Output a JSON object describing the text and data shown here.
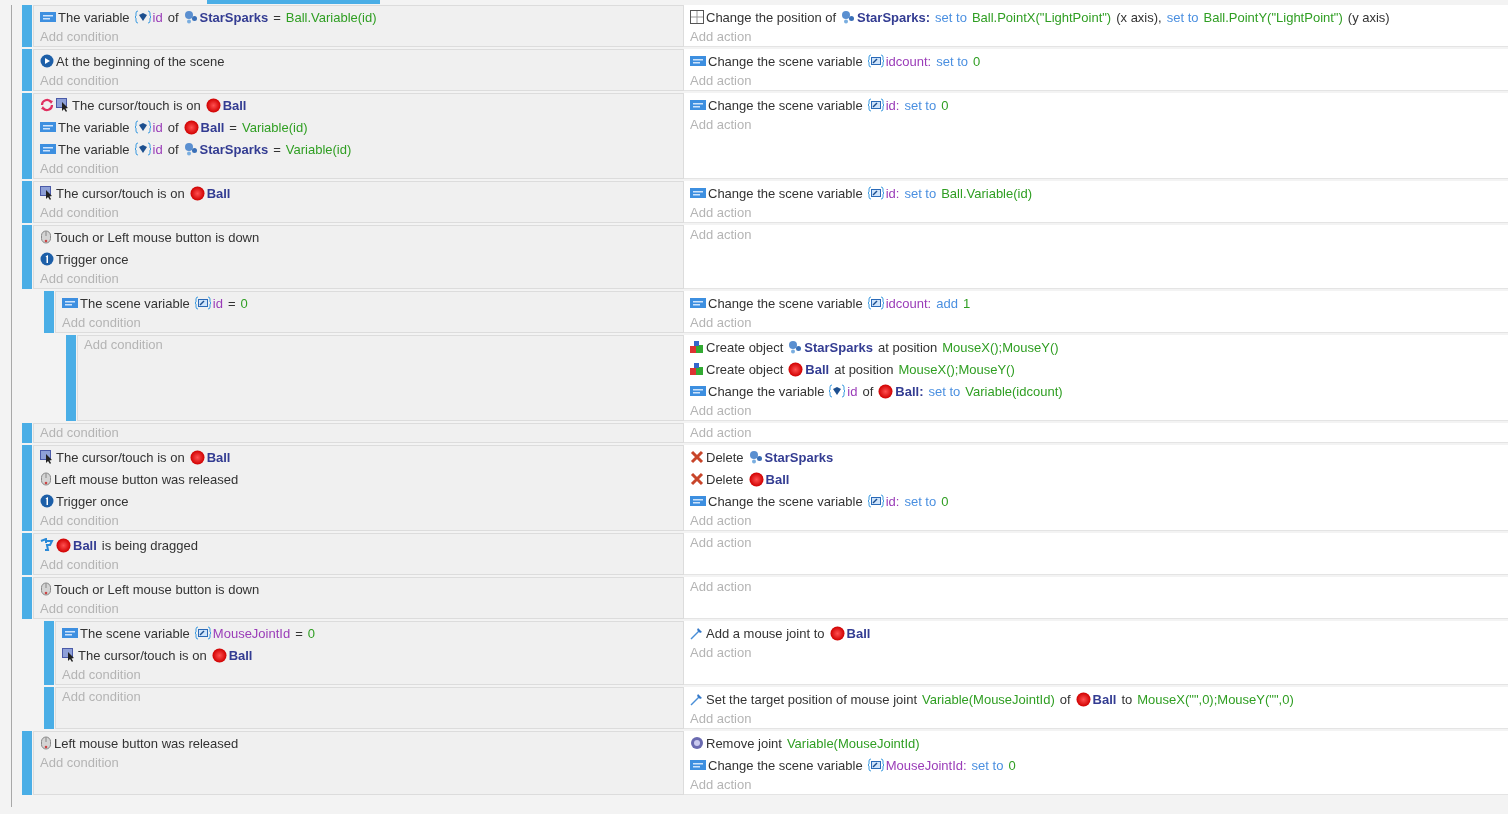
{
  "events": [
    {
      "conditions": [
        {
          "kind": "variable",
          "parts": [
            {
              "kind": "text",
              "text": "The variable"
            },
            {
              "kind": "object-variable",
              "text": "id"
            },
            {
              "kind": "text",
              "text": "of"
            },
            {
              "kind": "sparks",
              "text": "StarSparks"
            },
            {
              "kind": "operator",
              "text": "="
            },
            {
              "kind": "value",
              "text": "Ball.Variable(id)"
            }
          ]
        }
      ],
      "actions": [
        {
          "kind": "position",
          "parts": [
            {
              "kind": "text",
              "text": "Change the position of"
            },
            {
              "kind": "sparks",
              "text": "StarSparks:"
            },
            {
              "kind": "keyword",
              "text": "set to"
            },
            {
              "kind": "value",
              "text": "Ball.PointX(\"LightPoint\")"
            },
            {
              "kind": "text",
              "text": "(x axis),"
            },
            {
              "kind": "keyword",
              "text": "set to"
            },
            {
              "kind": "value",
              "text": "Ball.PointY(\"LightPoint\")"
            },
            {
              "kind": "text",
              "text": "(y axis)"
            }
          ]
        }
      ],
      "add_condition": "Add condition",
      "add_action": "Add action"
    },
    {
      "conditions": [
        {
          "kind": "start",
          "parts": [
            {
              "kind": "text",
              "text": "At the beginning of the scene"
            }
          ]
        }
      ],
      "actions": [
        {
          "kind": "variable",
          "parts": [
            {
              "kind": "text",
              "text": "Change the scene variable"
            },
            {
              "kind": "scene-variable",
              "text": "idcount:"
            },
            {
              "kind": "keyword",
              "text": "set to"
            },
            {
              "kind": "value",
              "text": "0"
            }
          ]
        }
      ],
      "add_condition": "Add condition",
      "add_action": "Add action"
    },
    {
      "conditions": [
        {
          "kind": "cursor",
          "inverted": true,
          "parts": [
            {
              "kind": "text",
              "text": "The cursor/touch is on"
            },
            {
              "kind": "ball",
              "text": "Ball"
            }
          ]
        },
        {
          "kind": "variable",
          "parts": [
            {
              "kind": "text",
              "text": "The variable"
            },
            {
              "kind": "object-variable",
              "text": "id"
            },
            {
              "kind": "text",
              "text": "of"
            },
            {
              "kind": "ball",
              "text": "Ball"
            },
            {
              "kind": "operator",
              "text": "="
            },
            {
              "kind": "value",
              "text": "Variable(id)"
            }
          ]
        },
        {
          "kind": "variable",
          "parts": [
            {
              "kind": "text",
              "text": "The variable"
            },
            {
              "kind": "object-variable",
              "text": "id"
            },
            {
              "kind": "text",
              "text": "of"
            },
            {
              "kind": "sparks",
              "text": "StarSparks"
            },
            {
              "kind": "operator",
              "text": "="
            },
            {
              "kind": "value",
              "text": "Variable(id)"
            }
          ]
        }
      ],
      "actions": [
        {
          "kind": "variable",
          "parts": [
            {
              "kind": "text",
              "text": "Change the scene variable"
            },
            {
              "kind": "scene-variable",
              "text": "id:"
            },
            {
              "kind": "keyword",
              "text": "set to"
            },
            {
              "kind": "value",
              "text": "0"
            }
          ]
        }
      ],
      "add_condition": "Add condition",
      "add_action": "Add action"
    },
    {
      "conditions": [
        {
          "kind": "cursor",
          "inverted": false,
          "parts": [
            {
              "kind": "text",
              "text": "The cursor/touch is on"
            },
            {
              "kind": "ball",
              "text": "Ball"
            }
          ]
        }
      ],
      "actions": [
        {
          "kind": "variable",
          "parts": [
            {
              "kind": "text",
              "text": "Change the scene variable"
            },
            {
              "kind": "scene-variable",
              "text": "id:"
            },
            {
              "kind": "keyword",
              "text": "set to"
            },
            {
              "kind": "value",
              "text": "Ball.Variable(id)"
            }
          ]
        }
      ],
      "add_condition": "Add condition",
      "add_action": "Add action"
    },
    {
      "conditions": [
        {
          "kind": "mouse",
          "parts": [
            {
              "kind": "text",
              "text": "Touch or Left mouse button is down"
            }
          ]
        },
        {
          "kind": "trigger",
          "parts": [
            {
              "kind": "text",
              "text": "Trigger once"
            }
          ]
        }
      ],
      "add_condition": "Add condition",
      "add_action": "Add action",
      "children": [
        {
          "conditions": [
            {
              "kind": "variable",
              "parts": [
                {
                  "kind": "text",
                  "text": "The scene variable"
                },
                {
                  "kind": "scene-variable",
                  "text": "id"
                },
                {
                  "kind": "operator",
                  "text": "="
                },
                {
                  "kind": "value",
                  "text": "0"
                }
              ]
            }
          ],
          "actions": [
            {
              "kind": "variable",
              "parts": [
                {
                  "kind": "text",
                  "text": "Change the scene variable"
                },
                {
                  "kind": "scene-variable",
                  "text": "idcount:"
                },
                {
                  "kind": "keyword",
                  "text": "add"
                },
                {
                  "kind": "value",
                  "text": "1"
                }
              ]
            }
          ],
          "add_condition": "Add condition",
          "add_action": "Add action",
          "children": [
            {
              "actions": [
                {
                  "kind": "create",
                  "parts": [
                    {
                      "kind": "text",
                      "text": "Create object"
                    },
                    {
                      "kind": "sparks",
                      "text": "StarSparks"
                    },
                    {
                      "kind": "text",
                      "text": "at position"
                    },
                    {
                      "kind": "value",
                      "text": "MouseX();MouseY()"
                    }
                  ]
                },
                {
                  "kind": "create",
                  "parts": [
                    {
                      "kind": "text",
                      "text": "Create object"
                    },
                    {
                      "kind": "ball",
                      "text": "Ball"
                    },
                    {
                      "kind": "text",
                      "text": "at position"
                    },
                    {
                      "kind": "value",
                      "text": "MouseX();MouseY()"
                    }
                  ]
                },
                {
                  "kind": "variable",
                  "parts": [
                    {
                      "kind": "text",
                      "text": "Change the variable"
                    },
                    {
                      "kind": "object-variable",
                      "text": "id"
                    },
                    {
                      "kind": "text",
                      "text": "of"
                    },
                    {
                      "kind": "ball",
                      "text": "Ball:"
                    },
                    {
                      "kind": "keyword",
                      "text": "set to"
                    },
                    {
                      "kind": "value",
                      "text": "Variable(idcount)"
                    }
                  ]
                }
              ],
              "add_condition": "Add condition",
              "add_action": "Add action"
            }
          ]
        }
      ]
    },
    {
      "add_condition": "Add condition",
      "add_action": "Add action"
    },
    {
      "conditions": [
        {
          "kind": "cursor",
          "inverted": false,
          "parts": [
            {
              "kind": "text",
              "text": "The cursor/touch is on"
            },
            {
              "kind": "ball",
              "text": "Ball"
            }
          ]
        },
        {
          "kind": "mouse",
          "parts": [
            {
              "kind": "text",
              "text": "Left mouse button was released"
            }
          ]
        },
        {
          "kind": "trigger",
          "parts": [
            {
              "kind": "text",
              "text": "Trigger once"
            }
          ]
        }
      ],
      "actions": [
        {
          "kind": "delete",
          "parts": [
            {
              "kind": "text",
              "text": "Delete"
            },
            {
              "kind": "sparks",
              "text": "StarSparks"
            }
          ]
        },
        {
          "kind": "delete",
          "parts": [
            {
              "kind": "text",
              "text": "Delete"
            },
            {
              "kind": "ball",
              "text": "Ball"
            }
          ]
        },
        {
          "kind": "variable",
          "parts": [
            {
              "kind": "text",
              "text": "Change the scene variable"
            },
            {
              "kind": "scene-variable",
              "text": "id:"
            },
            {
              "kind": "keyword",
              "text": "set to"
            },
            {
              "kind": "value",
              "text": "0"
            }
          ]
        }
      ],
      "add_condition": "Add condition",
      "add_action": "Add action"
    },
    {
      "conditions": [
        {
          "kind": "drag",
          "parts": [
            {
              "kind": "ball",
              "text": "Ball"
            },
            {
              "kind": "text",
              "text": "is being dragged"
            }
          ]
        }
      ],
      "add_condition": "Add condition",
      "add_action": "Add action"
    },
    {
      "conditions": [
        {
          "kind": "mouse",
          "parts": [
            {
              "kind": "text",
              "text": "Touch or Left mouse button is down"
            }
          ]
        }
      ],
      "add_condition": "Add condition",
      "add_action": "Add action",
      "children": [
        {
          "conditions": [
            {
              "kind": "variable",
              "parts": [
                {
                  "kind": "text",
                  "text": "The scene variable"
                },
                {
                  "kind": "scene-variable",
                  "text": "MouseJointId"
                },
                {
                  "kind": "operator",
                  "text": "="
                },
                {
                  "kind": "value",
                  "text": "0"
                }
              ]
            },
            {
              "kind": "cursor",
              "inverted": false,
              "parts": [
                {
                  "kind": "text",
                  "text": "The cursor/touch is on"
                },
                {
                  "kind": "ball",
                  "text": "Ball"
                }
              ]
            }
          ],
          "actions": [
            {
              "kind": "joint",
              "parts": [
                {
                  "kind": "text",
                  "text": "Add a mouse joint to"
                },
                {
                  "kind": "ball",
                  "text": "Ball"
                }
              ]
            }
          ],
          "add_condition": "Add condition",
          "add_action": "Add action"
        },
        {
          "actions": [
            {
              "kind": "joint",
              "parts": [
                {
                  "kind": "text",
                  "text": "Set the target position of mouse joint"
                },
                {
                  "kind": "value",
                  "text": "Variable(MouseJointId)"
                },
                {
                  "kind": "text",
                  "text": "of"
                },
                {
                  "kind": "ball",
                  "text": "Ball"
                },
                {
                  "kind": "text",
                  "text": "to"
                },
                {
                  "kind": "value",
                  "text": "MouseX(\"\",0);MouseY(\"\",0)"
                }
              ]
            }
          ],
          "add_condition": "Add condition",
          "add_action": "Add action"
        }
      ]
    },
    {
      "conditions": [
        {
          "kind": "mouse",
          "parts": [
            {
              "kind": "text",
              "text": "Left mouse button was released"
            }
          ]
        }
      ],
      "actions": [
        {
          "kind": "remove-joint",
          "parts": [
            {
              "kind": "text",
              "text": "Remove joint"
            },
            {
              "kind": "value",
              "text": "Variable(MouseJointId)"
            }
          ]
        },
        {
          "kind": "variable",
          "parts": [
            {
              "kind": "text",
              "text": "Change the scene variable"
            },
            {
              "kind": "scene-variable",
              "text": "MouseJointId:"
            },
            {
              "kind": "keyword",
              "text": "set to"
            },
            {
              "kind": "value",
              "text": "0"
            }
          ]
        }
      ],
      "add_condition": "Add condition",
      "add_action": "Add action"
    }
  ]
}
